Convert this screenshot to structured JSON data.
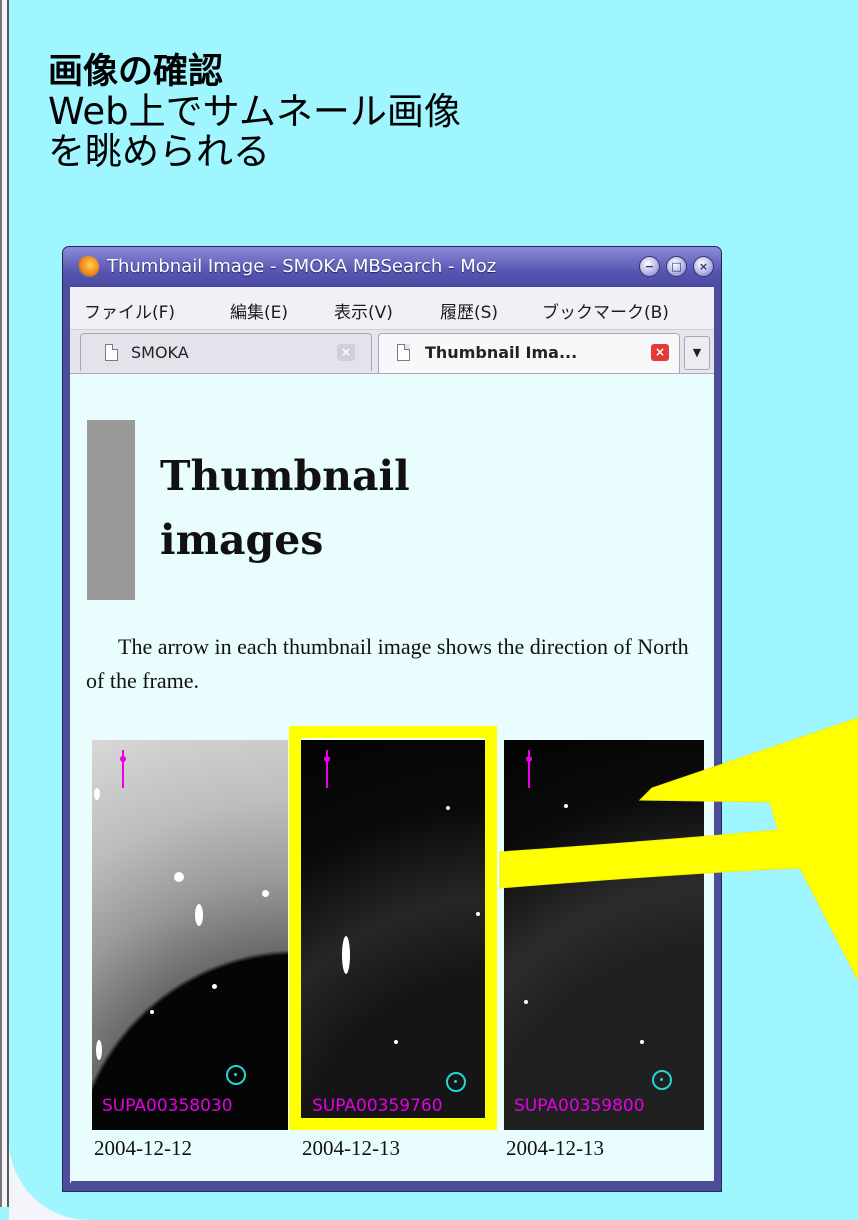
{
  "heading": {
    "line1": "画像の確認",
    "line2": "Web上でサムネール画像",
    "line3": "を眺められる"
  },
  "window": {
    "title": "Thumbnail Image - SMOKA MBSearch - Moz",
    "buttons": [
      "minimize",
      "maximize",
      "close"
    ]
  },
  "menubar": {
    "items": [
      "ファイル(F)",
      "編集(E)",
      "表示(V)",
      "履歴(S)",
      "ブックマーク(B)"
    ]
  },
  "tabs": [
    {
      "label": "SMOKA",
      "active": false
    },
    {
      "label": "Thumbnail Ima...",
      "active": true
    }
  ],
  "page": {
    "title_line1": "Thumbnail",
    "title_line2": "images",
    "description": "The arrow in each thumbnail image shows the direction of North of the frame."
  },
  "thumbnails": [
    {
      "frame_id": "SUPA00358030",
      "date": "2004-12-12"
    },
    {
      "frame_id": "SUPA00359760",
      "date": "2004-12-13"
    },
    {
      "frame_id": "SUPA00359800",
      "date": "2004-12-13"
    }
  ],
  "colors": {
    "slide_background": "#9ff6ff",
    "highlight": "#ffff00",
    "north_arrow": "#e800e8",
    "target_circle": "#23d6d6"
  }
}
